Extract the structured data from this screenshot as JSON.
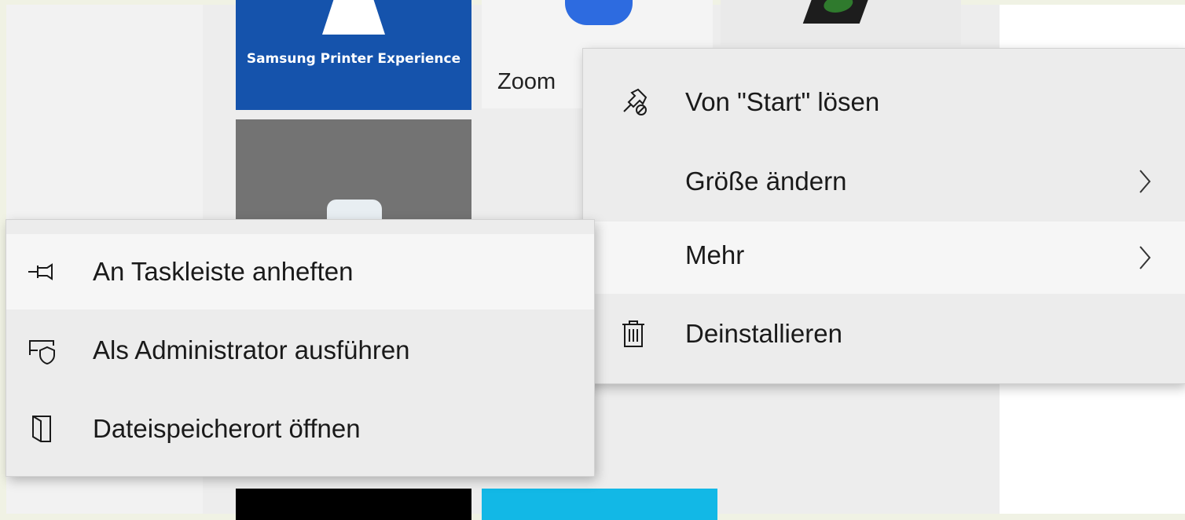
{
  "tiles": {
    "samsung": {
      "label": "Samsung Printer Experience",
      "color": "#1553ac"
    },
    "zoom": {
      "label": "Zoom",
      "icon_color": "#2d6be0"
    }
  },
  "context_menu": {
    "items": [
      {
        "label": "Von \"Start\" lösen",
        "icon": "unpin-icon"
      },
      {
        "label": "Größe ändern",
        "submenu": true
      },
      {
        "label": "Mehr",
        "submenu": true,
        "highlighted": true
      },
      {
        "label": "Deinstallieren",
        "icon": "trash-icon"
      }
    ]
  },
  "more_submenu": {
    "items": [
      {
        "label": "An Taskleiste anheften",
        "icon": "pin-taskbar-icon",
        "highlighted": true
      },
      {
        "label": "Als Administrator ausführen",
        "icon": "admin-shield-icon"
      },
      {
        "label": "Dateispeicherort öffnen",
        "icon": "file-location-icon"
      }
    ]
  },
  "colors": {
    "menu_bg": "#ececec",
    "highlight": "#f6f6f6",
    "accent_tile": "#1553ac"
  }
}
